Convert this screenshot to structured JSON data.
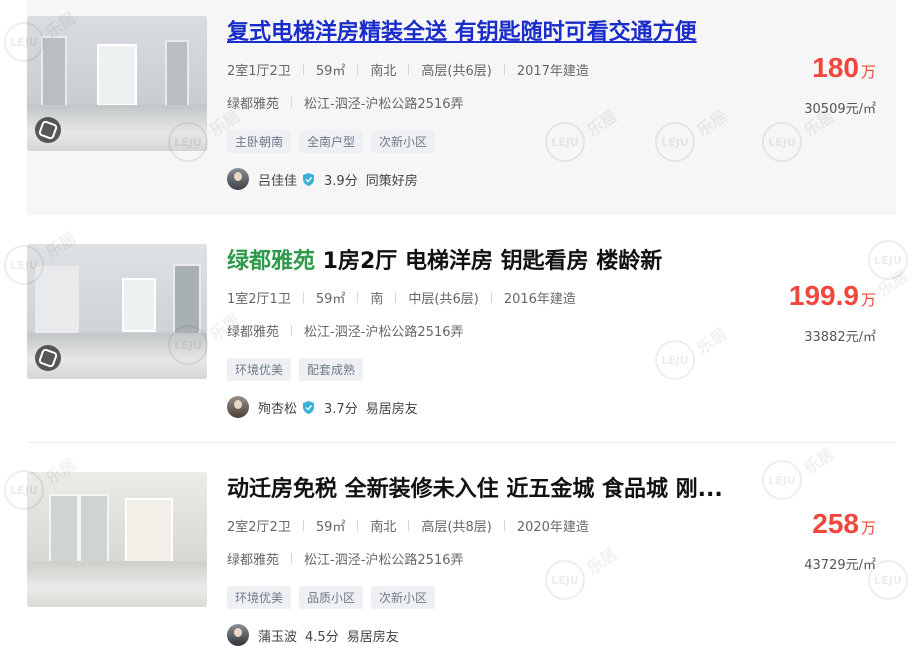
{
  "listings": [
    {
      "title": "复式电梯洋房精装全送 有钥匙随时可看交通方便",
      "title_highlight": "",
      "title_rest": "",
      "layout": "2室1厅2卫",
      "area": "59㎡",
      "orientation": "南北",
      "floor": "高层(共6层)",
      "built": "2017年建造",
      "community": "绿都雅苑",
      "location": "松江-泗泾-沪松公路2516弄",
      "tags": [
        "主卧朝南",
        "全南户型",
        "次新小区"
      ],
      "agent_name": "吕佳佳",
      "agent_score": "3.9分",
      "agent_company": "同策好房",
      "price": "180",
      "price_unit": "万",
      "unit_price": "30509元/㎡"
    },
    {
      "title": "",
      "title_highlight": "绿都雅苑",
      "title_rest": " 1房2厅 电梯洋房 钥匙看房 楼龄新",
      "layout": "1室2厅1卫",
      "area": "59㎡",
      "orientation": "南",
      "floor": "中层(共6层)",
      "built": "2016年建造",
      "community": "绿都雅苑",
      "location": "松江-泗泾-沪松公路2516弄",
      "tags": [
        "环境优美",
        "配套成熟"
      ],
      "agent_name": "殉杏松",
      "agent_score": "3.7分",
      "agent_company": "易居房友",
      "price": "199.9",
      "price_unit": "万",
      "unit_price": "33882元/㎡"
    },
    {
      "title": "动迁房免税 全新装修未入住 近五金城 食品城 刚...",
      "title_highlight": "",
      "title_rest": "",
      "layout": "2室2厅2卫",
      "area": "59㎡",
      "orientation": "南北",
      "floor": "高层(共8层)",
      "built": "2020年建造",
      "community": "绿都雅苑",
      "location": "松江-泗泾-沪松公路2516弄",
      "tags": [
        "环境优美",
        "品质小区",
        "次新小区"
      ],
      "agent_name": "蒲玉波",
      "agent_score": "4.5分",
      "agent_company": "易居房友",
      "price": "258",
      "price_unit": "万",
      "unit_price": "43729元/㎡"
    }
  ],
  "watermark_text": "乐居",
  "watermark_logo": "LEJU",
  "colors": {
    "price": "#f0473c",
    "link_title": "#1a2cc9",
    "highlight": "#2e9a4b"
  }
}
